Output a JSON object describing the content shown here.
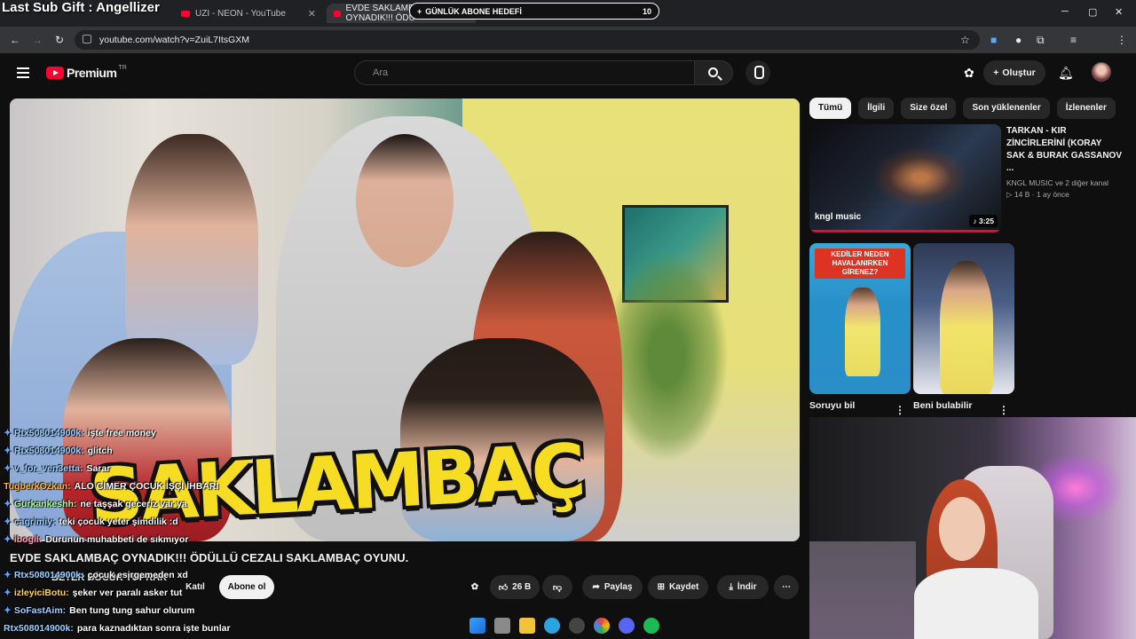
{
  "stream_overlay": {
    "last_sub": "Last Sub Gift : Angellizer",
    "goal_label": "GÜNLÜK ABONE HEDEFİ",
    "goal_count": "10"
  },
  "browser": {
    "tabs": [
      {
        "label": "UZI - NEON - YouTube"
      },
      {
        "label": "EVDE SAKLAMBAÇ OYNADIK!!! ÖDÜ"
      }
    ],
    "url": "youtube.com/watch?v=ZuiL7ItsGXM"
  },
  "header": {
    "logo_text": "Premium",
    "logo_country": "TR",
    "search_placeholder": "Ara",
    "create_label": "Oluştur"
  },
  "video": {
    "thumbnail_title": "SAKLAMBAÇ",
    "title": "EVDE SAKLAMBAÇ OYNADIK!!! ÖDÜLLÜ CEZALI SAKLAMBAÇ OYUNU.",
    "channel": "BETER BÖCÜK TOPRAK",
    "join_label": "Katıl",
    "subscribe_label": "Abone ol",
    "likes": "26 B",
    "share_label": "Paylaş",
    "save_label": "Kaydet",
    "download_label": "İndir"
  },
  "chat": [
    {
      "name": "Rtx508014900k:",
      "message": "işte free money",
      "color": "#9ad0ff"
    },
    {
      "name": "Rtx508014900k:",
      "message": "glitch",
      "color": "#9ad0ff"
    },
    {
      "name": "v_for_ven3etta:",
      "message": "Sarar",
      "color": "#9ad0ff"
    },
    {
      "name": "TugberkOzkan:",
      "message": "ALO CİMER ÇOCUK İŞÇİ İHBARI",
      "color": "#ffb347"
    },
    {
      "name": "Gurkankeshh:",
      "message": "ne taşşak geceriz var ya",
      "color": "#b2ff9e"
    },
    {
      "name": "cagrimiy:",
      "message": "teki çocuk yeter şimdilik :d",
      "color": "#9ad0ff"
    },
    {
      "name": "ibogil:",
      "message": "Durunun muhabbeti de sıkmıyor",
      "color": "#ff9eb5"
    },
    {
      "name": "Rtx508014900k:",
      "message": "çocuk esirgemeden xd",
      "color": "#9ad0ff"
    },
    {
      "name": "izleyiciBotu:",
      "message": "şeker ver paralı asker tut",
      "color": "#ffd24d"
    },
    {
      "name": "SoFastAim:",
      "message": "Ben tung tung sahur olurum",
      "color": "#9ad0ff"
    },
    {
      "name": "Rtx508014900k:",
      "message": "para kaznadıktan sonra işte bunlar",
      "color": "#9ad0ff"
    }
  ],
  "sidebar": {
    "chips": [
      "Tümü",
      "İlgili",
      "Size özel",
      "Son yüklenenler",
      "İzlenenler"
    ],
    "rec1": {
      "title": "TARKAN - KIR ZİNCİRLERİNİ (KORAY SAK & BURAK GASSANOV ...",
      "channel": "KNGL MUSIC ve 2 diğer kanal",
      "meta": "14 B · 1 ay önce",
      "duration": "3:25",
      "brand": "kngl music"
    },
    "shorts": [
      {
        "title": "Soruyu bil",
        "banner": "KEDİLER NEDEN HAVALANIRKEN GİRENEZ?"
      },
      {
        "title": "Beni bulabilir"
      }
    ]
  }
}
